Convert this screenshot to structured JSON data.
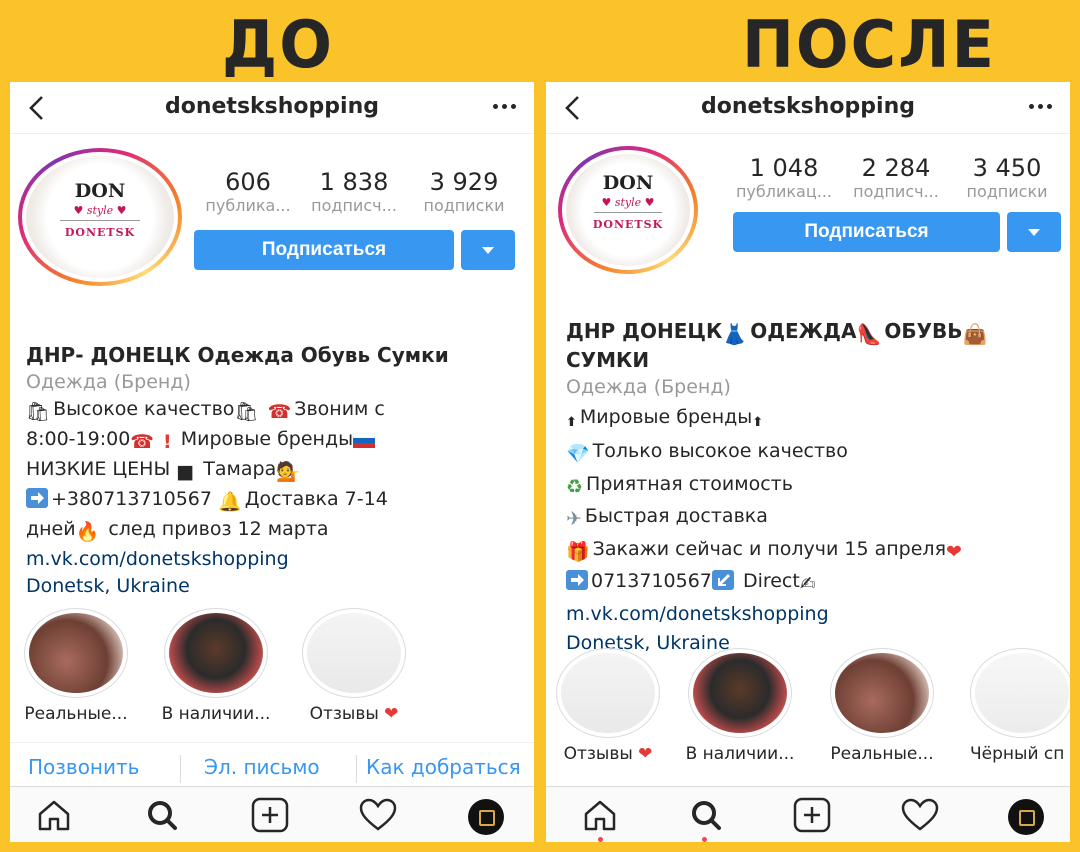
{
  "titles": {
    "before": "ДО",
    "after": "ПОСЛЕ"
  },
  "colors": {
    "background": "#FBC32A",
    "accent": "#3897f0",
    "link": "#003569"
  },
  "before": {
    "username": "donetskshopping",
    "logo": {
      "line1": "DON",
      "line2": "style",
      "line3": "DONETSK"
    },
    "stats": [
      {
        "value": "606",
        "label": "публика..."
      },
      {
        "value": "1 838",
        "label": "подписч..."
      },
      {
        "value": "3 929",
        "label": "подписки"
      }
    ],
    "follow_label": "Подписаться",
    "bio": {
      "name": "ДНР- ДОНЕЦК Одежда Обувь Сумки",
      "category": "Одежда (Бренд)",
      "line1": "Высокое качество",
      "line1b": "Звоним с",
      "line2": "8:00-19:00",
      "line2b": "Мировые бренды",
      "line3": "НИЗКИЕ ЦЕНЫ",
      "line3b": "Тамара",
      "line4": "+380713710567",
      "line4b": "Доставка 7-14",
      "line5": "дней",
      "line5b": "след привоз 12 марта",
      "link": "m.vk.com/donetskshopping",
      "location": "Donetsk, Ukraine"
    },
    "highlights": [
      {
        "label": "Реальные..."
      },
      {
        "label": "В наличии..."
      },
      {
        "label": "Отзывы"
      }
    ],
    "contacts": [
      {
        "label": "Позвонить"
      },
      {
        "label": "Эл. письмо"
      },
      {
        "label": "Как добраться"
      }
    ]
  },
  "after": {
    "username": "donetskshopping",
    "logo": {
      "line1": "DON",
      "line2": "style",
      "line3": "DONETSK"
    },
    "stats": [
      {
        "value": "1 048",
        "label": "публикац..."
      },
      {
        "value": "2 284",
        "label": "подписч..."
      },
      {
        "value": "3 450",
        "label": "подписки"
      }
    ],
    "follow_label": "Подписаться",
    "bio": {
      "name1": "ДНР ДОНЕЦК",
      "name2": "ОДЕЖДА",
      "name3": "ОБУВЬ",
      "name4": "СУМКИ",
      "category": "Одежда (Бренд)",
      "line1": "Мировые бренды",
      "line2": "Только высокое качество",
      "line3": "Приятная стоимость",
      "line4": "Быстрая доставка",
      "line5": "Закажи сейчас и получи 15 апреля",
      "line6a": "0713710567",
      "line6b": "Direct",
      "link": "m.vk.com/donetskshopping",
      "location": "Donetsk, Ukraine"
    },
    "highlights": [
      {
        "label": "Отзывы"
      },
      {
        "label": "В наличии..."
      },
      {
        "label": "Реальные..."
      },
      {
        "label": "Чёрный сп"
      }
    ]
  }
}
